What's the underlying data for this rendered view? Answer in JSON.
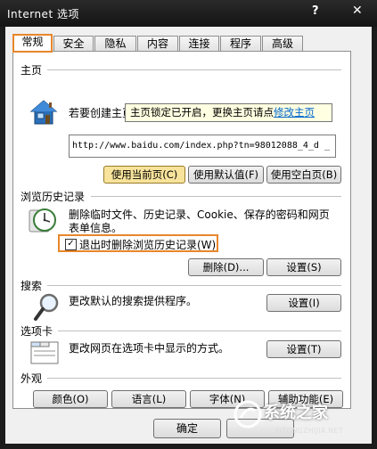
{
  "window": {
    "title": "Internet 选项",
    "help": "?",
    "close": "✕"
  },
  "tabs": [
    {
      "label": "常规",
      "active": true
    },
    {
      "label": "安全"
    },
    {
      "label": "隐私"
    },
    {
      "label": "内容"
    },
    {
      "label": "连接"
    },
    {
      "label": "程序"
    },
    {
      "label": "高级"
    }
  ],
  "home": {
    "group_title": "主页",
    "description": "若要创建主页",
    "tooltip_text": "主页锁定已开启，更换主页请点",
    "tooltip_link": "修改主页",
    "url": "http://www.baidu.com/index.php?tn=98012088_4_d _",
    "btn_current": "使用当前页(C)",
    "btn_default": "使用默认值(F)",
    "btn_blank": "使用空白页(B)"
  },
  "history": {
    "group_title": "浏览历史记录",
    "description": "删除临时文件、历史记录、Cookie、保存的密码和网页表单信息。",
    "checkbox_label": "退出时删除浏览历史记录(W)",
    "checkbox_checked": true,
    "check_mark": "✓",
    "btn_delete": "删除(D)...",
    "btn_settings": "设置(S)"
  },
  "search": {
    "group_title": "搜索",
    "description": "更改默认的搜索提供程序。",
    "btn_settings": "设置(I)"
  },
  "tabs_group": {
    "group_title": "选项卡",
    "description": "更改网页在选项卡中显示的方式。",
    "btn_settings": "设置(T)"
  },
  "appearance": {
    "group_title": "外观",
    "btn_colors": "颜色(O)",
    "btn_languages": "语言(L)",
    "btn_fonts": "字体(N)",
    "btn_accessibility": "辅助功能(E)"
  },
  "footer": {
    "btn_ok": "确定"
  },
  "watermark": {
    "text": "系统之家",
    "sub": "XITONGZHIJIA.NET"
  },
  "colors": {
    "highlight": "#e8862c",
    "link": "#0066cc",
    "tooltip_bg": "#ffffe1",
    "titlebar": "#1c1c1c"
  }
}
